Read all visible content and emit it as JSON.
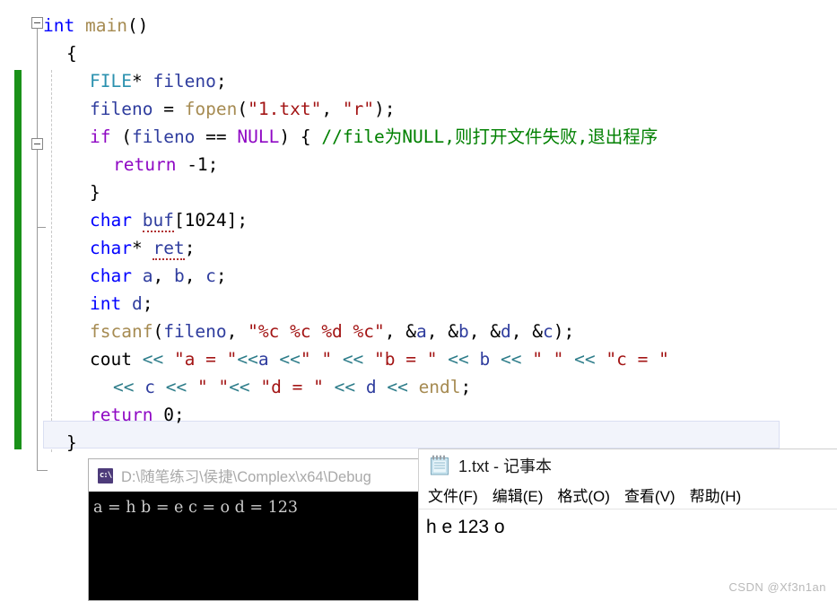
{
  "editor": {
    "lines": [
      {
        "indent": 0,
        "tokens": [
          {
            "t": "int ",
            "c": "kw"
          },
          {
            "t": "main",
            "c": "fn"
          },
          {
            "t": "()",
            "c": "pun"
          }
        ]
      },
      {
        "indent": 1,
        "tokens": [
          {
            "t": "{",
            "c": "pun"
          }
        ]
      },
      {
        "indent": 2,
        "tokens": [
          {
            "t": "FILE",
            "c": "type"
          },
          {
            "t": "* ",
            "c": "pun"
          },
          {
            "t": "fileno",
            "c": "var"
          },
          {
            "t": ";",
            "c": "pun"
          }
        ]
      },
      {
        "indent": 2,
        "tokens": [
          {
            "t": "fileno ",
            "c": "var"
          },
          {
            "t": "= ",
            "c": "pun"
          },
          {
            "t": "fopen",
            "c": "fn"
          },
          {
            "t": "(",
            "c": "pun"
          },
          {
            "t": "\"1.txt\"",
            "c": "str"
          },
          {
            "t": ", ",
            "c": "pun"
          },
          {
            "t": "\"r\"",
            "c": "str"
          },
          {
            "t": ");",
            "c": "pun"
          }
        ]
      },
      {
        "indent": 2,
        "tokens": [
          {
            "t": "if ",
            "c": "ctrl"
          },
          {
            "t": "(",
            "c": "pun"
          },
          {
            "t": "fileno ",
            "c": "var"
          },
          {
            "t": "== ",
            "c": "pun"
          },
          {
            "t": "NULL",
            "c": "ctrl"
          },
          {
            "t": ") { ",
            "c": "pun"
          },
          {
            "t": "//file为NULL,则打开文件失败,退出程序",
            "c": "cmt"
          }
        ]
      },
      {
        "indent": 3,
        "tokens": [
          {
            "t": "return ",
            "c": "ctrl"
          },
          {
            "t": "-1;",
            "c": "pun"
          }
        ]
      },
      {
        "indent": 2,
        "tokens": [
          {
            "t": "}",
            "c": "pun"
          }
        ]
      },
      {
        "indent": 2,
        "tokens": [
          {
            "t": "char ",
            "c": "kw"
          },
          {
            "t": "buf",
            "c": "var sq"
          },
          {
            "t": "[1024];",
            "c": "pun"
          }
        ]
      },
      {
        "indent": 2,
        "tokens": [
          {
            "t": "char",
            "c": "kw"
          },
          {
            "t": "* ",
            "c": "pun"
          },
          {
            "t": "ret",
            "c": "var sq"
          },
          {
            "t": ";",
            "c": "pun"
          }
        ]
      },
      {
        "indent": 2,
        "tokens": [
          {
            "t": "char ",
            "c": "kw"
          },
          {
            "t": "a",
            "c": "var"
          },
          {
            "t": ", ",
            "c": "pun"
          },
          {
            "t": "b",
            "c": "var"
          },
          {
            "t": ", ",
            "c": "pun"
          },
          {
            "t": "c",
            "c": "var"
          },
          {
            "t": ";",
            "c": "pun"
          }
        ]
      },
      {
        "indent": 2,
        "tokens": [
          {
            "t": "int ",
            "c": "kw"
          },
          {
            "t": "d",
            "c": "var"
          },
          {
            "t": ";",
            "c": "pun"
          }
        ]
      },
      {
        "indent": 2,
        "tokens": [
          {
            "t": "fscanf",
            "c": "fn"
          },
          {
            "t": "(",
            "c": "pun"
          },
          {
            "t": "fileno",
            "c": "var"
          },
          {
            "t": ", ",
            "c": "pun"
          },
          {
            "t": "\"%c %c %d %c\"",
            "c": "str"
          },
          {
            "t": ", &",
            "c": "pun"
          },
          {
            "t": "a",
            "c": "var"
          },
          {
            "t": ", &",
            "c": "pun"
          },
          {
            "t": "b",
            "c": "var"
          },
          {
            "t": ", &",
            "c": "pun"
          },
          {
            "t": "d",
            "c": "var"
          },
          {
            "t": ", &",
            "c": "pun"
          },
          {
            "t": "c",
            "c": "var"
          },
          {
            "t": ");",
            "c": "pun"
          }
        ]
      },
      {
        "indent": 2,
        "tokens": [
          {
            "t": "cout ",
            "c": "pun"
          },
          {
            "t": "<< ",
            "c": "op"
          },
          {
            "t": "\"a = \"",
            "c": "str"
          },
          {
            "t": "<<",
            "c": "op"
          },
          {
            "t": "a ",
            "c": "var"
          },
          {
            "t": "<<",
            "c": "op"
          },
          {
            "t": "\" \" ",
            "c": "str"
          },
          {
            "t": "<< ",
            "c": "op"
          },
          {
            "t": "\"b = \" ",
            "c": "str"
          },
          {
            "t": "<< ",
            "c": "op"
          },
          {
            "t": "b ",
            "c": "var"
          },
          {
            "t": "<< ",
            "c": "op"
          },
          {
            "t": "\" \" ",
            "c": "str"
          },
          {
            "t": "<< ",
            "c": "op"
          },
          {
            "t": "\"c = \"",
            "c": "str"
          }
        ]
      },
      {
        "indent": 3,
        "tokens": [
          {
            "t": "<< ",
            "c": "op"
          },
          {
            "t": "c ",
            "c": "var"
          },
          {
            "t": "<< ",
            "c": "op"
          },
          {
            "t": "\" \"",
            "c": "str"
          },
          {
            "t": "<< ",
            "c": "op"
          },
          {
            "t": "\"d = \" ",
            "c": "str"
          },
          {
            "t": "<< ",
            "c": "op"
          },
          {
            "t": "d ",
            "c": "var"
          },
          {
            "t": "<< ",
            "c": "op"
          },
          {
            "t": "endl",
            "c": "fn"
          },
          {
            "t": ";",
            "c": "pun"
          }
        ]
      },
      {
        "indent": 2,
        "tokens": [
          {
            "t": "return ",
            "c": "ctrl"
          },
          {
            "t": "0;",
            "c": "pun"
          }
        ]
      },
      {
        "indent": 1,
        "tokens": [
          {
            "t": "}",
            "c": "pun"
          }
        ]
      }
    ]
  },
  "console": {
    "title": "D:\\随笔练习\\侯捷\\Complex\\x64\\Debug",
    "icon": "cmd-prompt-icon",
    "output": "a = h b = e c = o d = 123"
  },
  "notepad": {
    "title": "1.txt - 记事本",
    "icon": "notepad-icon",
    "menu": [
      {
        "label": "文件(F)"
      },
      {
        "label": "编辑(E)"
      },
      {
        "label": "格式(O)"
      },
      {
        "label": "查看(V)"
      },
      {
        "label": "帮助(H)"
      }
    ],
    "content": "h e 123 o"
  },
  "watermark": {
    "text": "CSDN @Xf3n1an"
  },
  "colors": {
    "keyword": "#0000ff",
    "control": "#8f08c4",
    "type": "#2b91af",
    "identifier": "#2f3d9e",
    "function": "#a68b52",
    "string": "#a31515",
    "operator": "#2e7d8a",
    "comment": "#008000",
    "change_bar": "#1a9119",
    "current_line_bg": "#f2f4fb",
    "console_bg": "#000000",
    "console_fg": "#cccccc"
  }
}
